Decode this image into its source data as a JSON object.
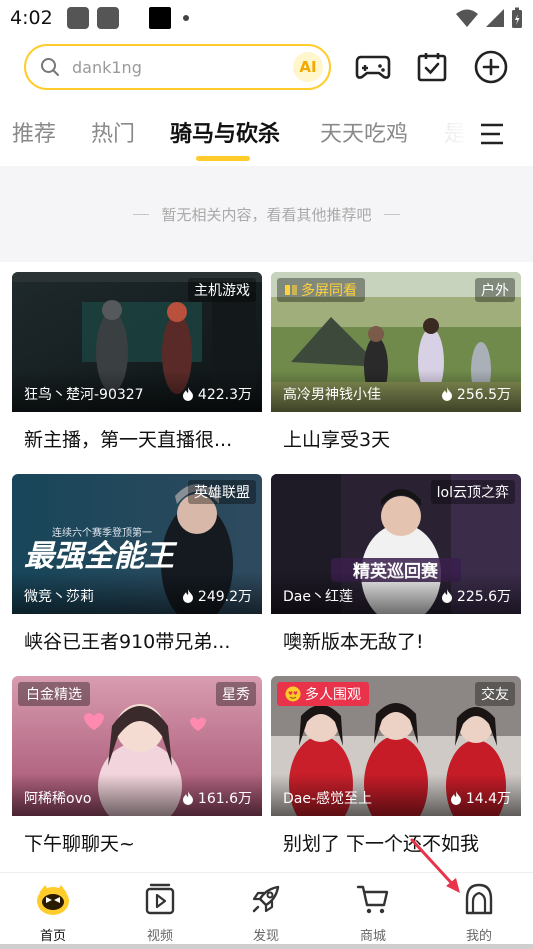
{
  "status_bar": {
    "time": "4:02"
  },
  "search": {
    "placeholder": "dank1ng",
    "ai_label": "AI"
  },
  "tabs": [
    {
      "label": "推荐"
    },
    {
      "label": "热门"
    },
    {
      "label": "骑马与砍杀"
    },
    {
      "label": "天天吃鸡"
    },
    {
      "label": "是"
    }
  ],
  "empty_notice": "暂无相关内容，看看其他推荐吧",
  "cards": [
    {
      "category": "主机游戏",
      "tag": "",
      "streamer": "狂鸟丶楚河-90327",
      "views": "422.3万",
      "title": "新主播，第一天直播很..."
    },
    {
      "category": "户外",
      "tag": "多屏同看",
      "streamer": "高冷男神钱小佳",
      "views": "256.5万",
      "title": "上山享受3天"
    },
    {
      "category": "英雄联盟",
      "tag": "",
      "streamer": "微竞丶莎莉",
      "views": "249.2万",
      "title": "峡谷已王者910带兄弟..."
    },
    {
      "category": "lol云顶之弈",
      "tag": "",
      "streamer": "Dae丶红莲",
      "views": "225.6万",
      "title": "噢新版本无敌了!"
    },
    {
      "category": "星秀",
      "tag": "白金精选",
      "streamer": "阿稀稀ovo",
      "views": "161.6万",
      "title": "下午聊聊天~"
    },
    {
      "category": "交友",
      "tag": "多人围观",
      "streamer": "Dae-感觉至上",
      "views": "14.4万",
      "title": "别划了 下一个还不如我"
    }
  ],
  "card_art": [
    {
      "banner": "",
      "sub": ""
    },
    {
      "banner": "",
      "sub": ""
    },
    {
      "banner": "最强全能王",
      "sub": "连续六个赛季登顶第一"
    },
    {
      "banner": "精英巡回赛",
      "sub": ""
    },
    {
      "banner": "",
      "sub": ""
    },
    {
      "banner": "",
      "sub": ""
    }
  ],
  "bottom_nav": [
    {
      "label": "首页",
      "icon": "home-mascot-icon"
    },
    {
      "label": "视频",
      "icon": "video-icon"
    },
    {
      "label": "发现",
      "icon": "rocket-icon"
    },
    {
      "label": "商城",
      "icon": "cart-icon"
    },
    {
      "label": "我的",
      "icon": "profile-icon"
    }
  ],
  "colors": {
    "accent": "#ffcc2b",
    "text": "#111111",
    "muted": "#8a8a8a",
    "live_tag": "#e8334a"
  }
}
